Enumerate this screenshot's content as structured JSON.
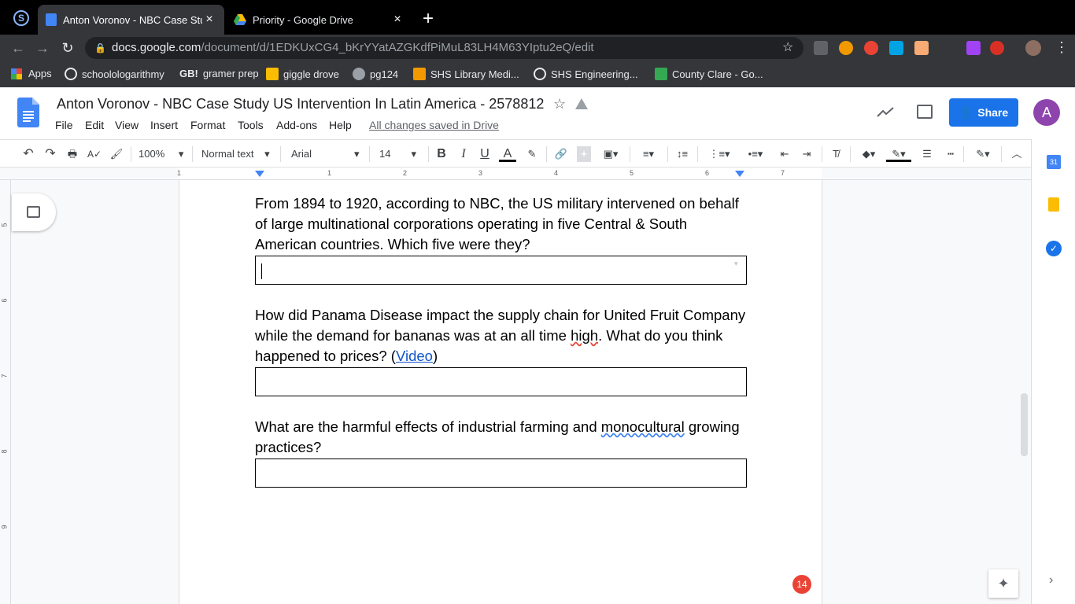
{
  "tabs": [
    {
      "title": "Anton Voronov - NBC Case Stu",
      "close": "×"
    },
    {
      "title": "Priority - Google Drive",
      "close": "×"
    }
  ],
  "new_tab": "+",
  "url": {
    "host": "docs.google.com",
    "path": "/document/d/1EDKUxCG4_bKrYYatAZGKdfPiMuL83LH4M63YIptu2eQ/edit"
  },
  "bookmarks": [
    {
      "label": "Apps",
      "color": "#ea4335"
    },
    {
      "label": "schoolologarithmy",
      "color": "#3c4043"
    },
    {
      "label": "gramer prep",
      "color": "#202124"
    },
    {
      "label": "giggle drove",
      "color": "#fbbc04"
    },
    {
      "label": "pg124",
      "color": "#9aa0a6"
    },
    {
      "label": "SHS Library Medi...",
      "color": "#f29900"
    },
    {
      "label": "SHS Engineering...",
      "color": "#3c4043"
    },
    {
      "label": "County Clare - Go...",
      "color": "#34a853"
    }
  ],
  "doc": {
    "title": "Anton Voronov - NBC Case Study US Intervention In Latin America - 2578812",
    "menus": [
      "File",
      "Edit",
      "View",
      "Insert",
      "Format",
      "Tools",
      "Add-ons",
      "Help"
    ],
    "saved_status": "All changes saved in Drive",
    "share_label": "Share",
    "avatar_letter": "A"
  },
  "toolbar": {
    "zoom": "100%",
    "style": "Normal text",
    "font": "Arial",
    "size": "14"
  },
  "ruler_numbers": [
    "1",
    "1",
    "2",
    "3",
    "4",
    "5",
    "6",
    "7"
  ],
  "vruler_numbers": [
    "5",
    "6",
    "7",
    "8",
    "9"
  ],
  "questions": [
    {
      "text": "From 1894 to 1920, according to NBC, the US military intervened on behalf of large multinational corporations operating in five Central & South American countries. Which five were they?"
    },
    {
      "pre": "How did Panama Disease impact the supply chain for United Fruit Company while the demand for bananas was at an all time ",
      "spell": "high",
      "mid": ". What do you think happened to prices? (",
      "link": "Video",
      "post": ")"
    },
    {
      "pre": "What are the harmful effects of industrial farming and ",
      "gram": "monocultural",
      "post": " growing practices?"
    }
  ],
  "comment_badge": "14",
  "colors": {
    "share": "#1a73e8",
    "avatar": "#8e44ad",
    "badge": "#ea4335",
    "link": "#1155cc"
  }
}
